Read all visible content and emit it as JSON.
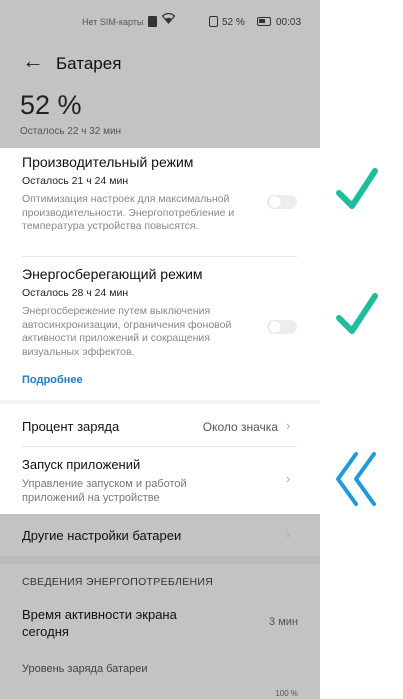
{
  "status_bar": {
    "sim_text": "Нет SIM-карты",
    "battery_percent": "52 %",
    "time": "00:03"
  },
  "header": {
    "title": "Батарея",
    "battery_level": "52 %",
    "time_left": "Осталось 22 ч 32 мин"
  },
  "performance_mode": {
    "title": "Производительный режим",
    "time_left": "Осталось 21 ч 24 мин",
    "description": "Оптимизация настроек для максимальной производительности. Энергопотребление и температура устройства повысятся.",
    "enabled": false
  },
  "power_saving_mode": {
    "title": "Энергосберегающий режим",
    "time_left": "Осталось 28 ч 24 мин",
    "description": "Энергосбережение путем выключения автосинхронизации, ограничения фоновой активности приложений и сокращения визуальных эффектов.",
    "enabled": false
  },
  "more_link": "Подробнее",
  "charge_percent_row": {
    "title": "Процент заряда",
    "value": "Около значка"
  },
  "app_launch_row": {
    "title": "Запуск приложений",
    "subtitle": "Управление запуском и работой приложений на устройстве"
  },
  "other_settings_row": {
    "title": "Другие настройки батареи"
  },
  "usage_section": {
    "header": "СВЕДЕНИЯ ЭНЕРГОПОТРЕБЛЕНИЯ",
    "screen_time_label": "Время активности экрана сегодня",
    "screen_time_value": "3 мин",
    "battery_level_label": "Уровень заряда батареи",
    "battery_level_value": "100 %"
  },
  "annotations": {
    "check_color": "#1bbf9b",
    "arrow_color": "#1a9be0"
  }
}
